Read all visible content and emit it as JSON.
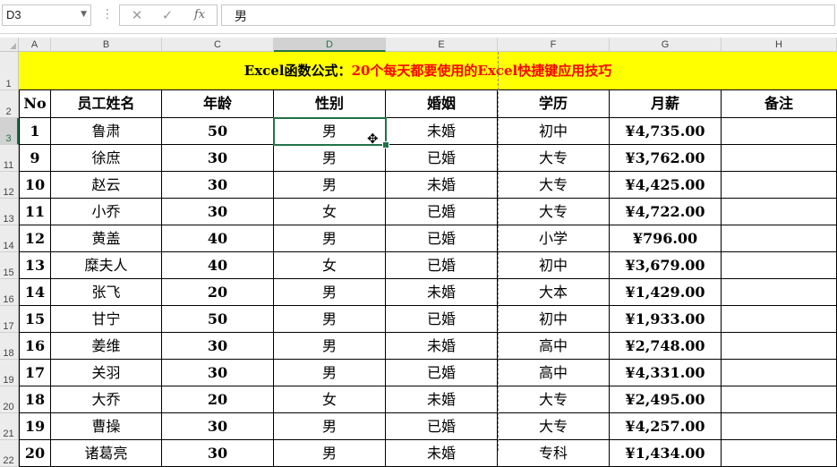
{
  "formula_bar": {
    "name_box": "D3",
    "cancel_icon": "✕",
    "enter_icon": "✓",
    "fx_label": "fx",
    "content": "男"
  },
  "columns": [
    "A",
    "B",
    "C",
    "D",
    "E",
    "F",
    "G",
    "H"
  ],
  "selected_column": "D",
  "title": {
    "part1": "Excel函数公式：",
    "part2": "20个每天都要使用的Excel快捷键应用技巧"
  },
  "headers": [
    "No",
    "员工姓名",
    "年龄",
    "性别",
    "婚姻",
    "学历",
    "月薪",
    "备注"
  ],
  "header_row_num": "2",
  "title_row_num": "1",
  "rows": [
    {
      "row": "3",
      "no": "1",
      "name": "鲁肃",
      "age": "50",
      "gender": "男",
      "marital": "未婚",
      "edu": "初中",
      "salary": "¥4,735.00",
      "note": ""
    },
    {
      "row": "11",
      "no": "9",
      "name": "徐庶",
      "age": "30",
      "gender": "男",
      "marital": "已婚",
      "edu": "大专",
      "salary": "¥3,762.00",
      "note": ""
    },
    {
      "row": "12",
      "no": "10",
      "name": "赵云",
      "age": "30",
      "gender": "男",
      "marital": "未婚",
      "edu": "大专",
      "salary": "¥4,425.00",
      "note": ""
    },
    {
      "row": "13",
      "no": "11",
      "name": "小乔",
      "age": "30",
      "gender": "女",
      "marital": "已婚",
      "edu": "大专",
      "salary": "¥4,722.00",
      "note": ""
    },
    {
      "row": "14",
      "no": "12",
      "name": "黄盖",
      "age": "40",
      "gender": "男",
      "marital": "已婚",
      "edu": "小学",
      "salary": "¥796.00",
      "note": ""
    },
    {
      "row": "15",
      "no": "13",
      "name": "糜夫人",
      "age": "40",
      "gender": "女",
      "marital": "已婚",
      "edu": "初中",
      "salary": "¥3,679.00",
      "note": ""
    },
    {
      "row": "16",
      "no": "14",
      "name": "张飞",
      "age": "20",
      "gender": "男",
      "marital": "未婚",
      "edu": "大本",
      "salary": "¥1,429.00",
      "note": ""
    },
    {
      "row": "17",
      "no": "15",
      "name": "甘宁",
      "age": "50",
      "gender": "男",
      "marital": "已婚",
      "edu": "初中",
      "salary": "¥1,933.00",
      "note": ""
    },
    {
      "row": "18",
      "no": "16",
      "name": "姜维",
      "age": "30",
      "gender": "男",
      "marital": "未婚",
      "edu": "高中",
      "salary": "¥2,748.00",
      "note": ""
    },
    {
      "row": "19",
      "no": "17",
      "name": "关羽",
      "age": "30",
      "gender": "男",
      "marital": "已婚",
      "edu": "高中",
      "salary": "¥4,331.00",
      "note": ""
    },
    {
      "row": "20",
      "no": "18",
      "name": "大乔",
      "age": "20",
      "gender": "女",
      "marital": "未婚",
      "edu": "大专",
      "salary": "¥2,495.00",
      "note": ""
    },
    {
      "row": "21",
      "no": "19",
      "name": "曹操",
      "age": "30",
      "gender": "男",
      "marital": "已婚",
      "edu": "大专",
      "salary": "¥4,257.00",
      "note": ""
    },
    {
      "row": "22",
      "no": "20",
      "name": "诸葛亮",
      "age": "30",
      "gender": "男",
      "marital": "未婚",
      "edu": "专科",
      "salary": "¥1,434.00",
      "note": ""
    }
  ],
  "selected_cell": "D3",
  "cursor_icon": "move-cursor-icon"
}
